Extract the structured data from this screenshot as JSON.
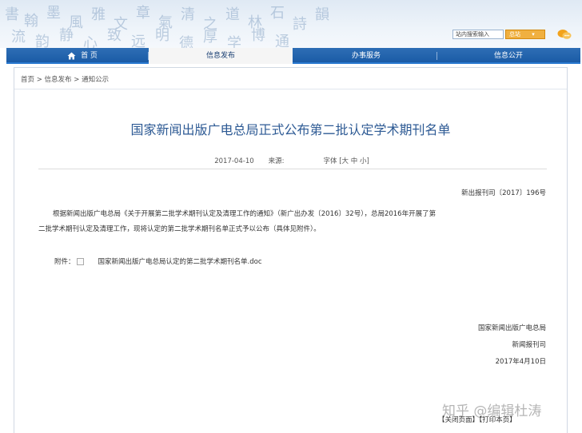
{
  "header": {
    "search_placeholder": "站内搜索输入",
    "search_scope": "总站"
  },
  "nav": {
    "items": [
      {
        "label": "首 页"
      },
      {
        "label": "信息发布"
      },
      {
        "label": "办事服务"
      },
      {
        "label": "信息公开"
      }
    ]
  },
  "breadcrumb": {
    "home": "首页",
    "sep": " > ",
    "level1": "信息发布",
    "level2": "通知公示"
  },
  "article": {
    "title": "国家新闻出版广电总局正式公布第二批认定学术期刊名单",
    "date": "2017-04-10",
    "source_label": "来源:",
    "font_label": "字体 [大 中 小]",
    "doc_number": "新出报刊司〔2017〕196号",
    "paragraph_line1": "根据新闻出版广电总局《关于开展第二批学术期刊认定及清理工作的通知》（新广出办发〔2016〕32号），总局2016年开展了第",
    "paragraph_line2": "二批学术期刊认定及清理工作，现将认定的第二批学术期刊名单正式予以公布（具体见附件）。",
    "attachment_label": "附件：",
    "attachment_link": "国家新闻出版广电总局认定的第二批学术期刊名单.doc",
    "signature_org": "国家新闻出版广电总局",
    "signature_dept": "新闻报刊司",
    "signature_date": "2017年4月10日"
  },
  "footer": {
    "close": "【关闭页面】",
    "print": "【打印本页】"
  },
  "watermark": "知乎 @编辑杜涛",
  "colors": {
    "nav_bg": "#1a5ba6",
    "title": "#2d5a94",
    "search_select": "#f0b040"
  }
}
